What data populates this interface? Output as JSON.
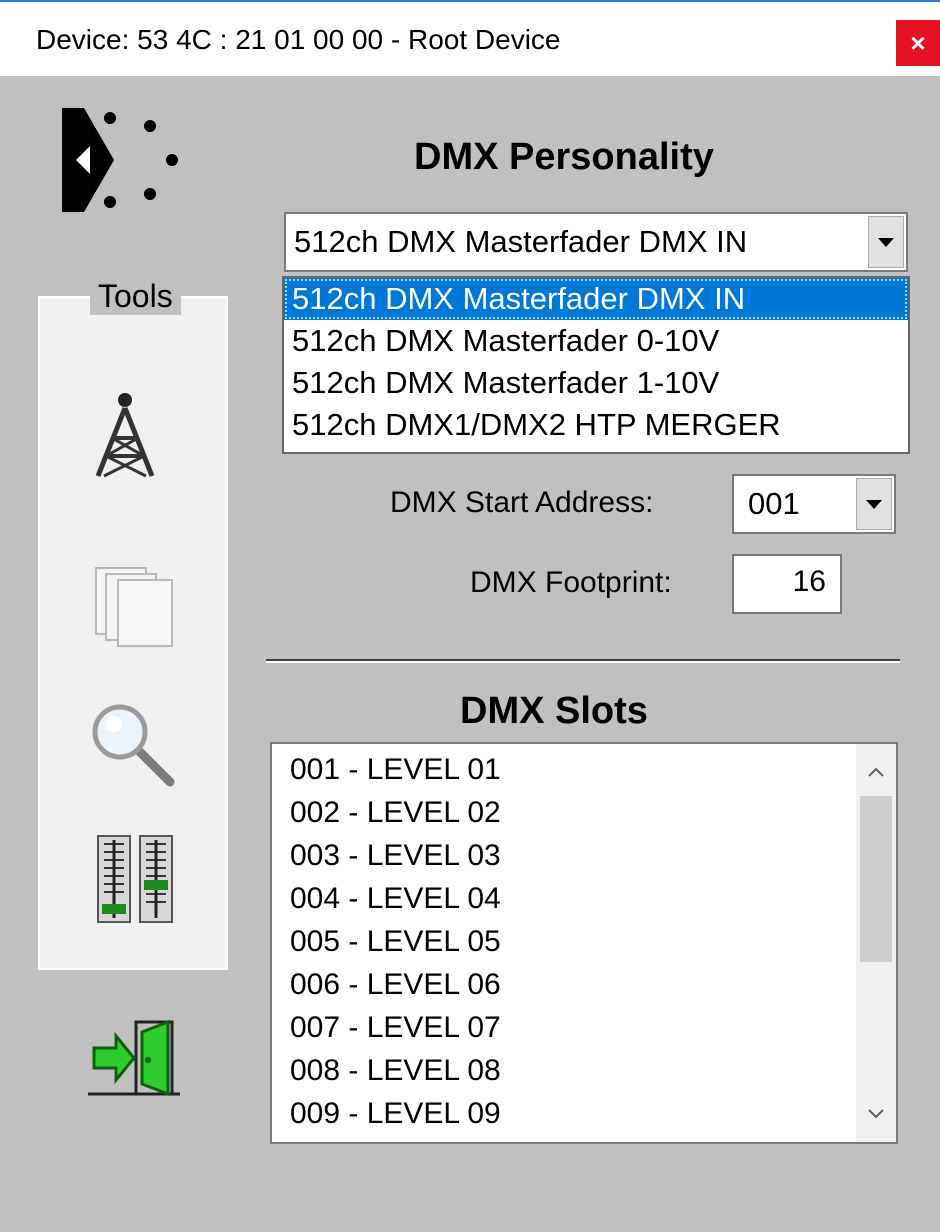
{
  "window": {
    "title": "Device:  53 4C : 21 01 00 00 - Root Device",
    "close_label": "×"
  },
  "personality": {
    "heading": "DMX Personality",
    "selected": "512ch DMX Masterfader  DMX IN",
    "options": [
      "512ch DMX Masterfader  DMX IN",
      "512ch DMX Masterfader  0-10V",
      "512ch DMX Masterfader  1-10V",
      "512ch DMX1/DMX2 HTP MERGER"
    ],
    "selected_index": 0
  },
  "start_address": {
    "label": "DMX Start Address:",
    "value": "001"
  },
  "footprint": {
    "label": "DMX Footprint:",
    "value": "16"
  },
  "slots": {
    "heading": "DMX Slots",
    "items": [
      "001 - LEVEL  01",
      "002 - LEVEL  02",
      "003 - LEVEL  03",
      "004 - LEVEL  04",
      "005 - LEVEL  05",
      "006 - LEVEL  06",
      "007 - LEVEL  07",
      "008 - LEVEL  08",
      "009 - LEVEL  09"
    ]
  },
  "tools": {
    "legend": "Tools",
    "icons": [
      "antenna-tower-icon",
      "pages-icon",
      "magnifier-icon",
      "faders-icon"
    ]
  },
  "exit": {
    "icon": "exit-door-icon"
  },
  "colors": {
    "background": "#c0c0c0",
    "selection": "#0078d7",
    "close": "#e81123",
    "fader_led": "#1f8a1f",
    "exit_green": "#2ecc2e"
  }
}
